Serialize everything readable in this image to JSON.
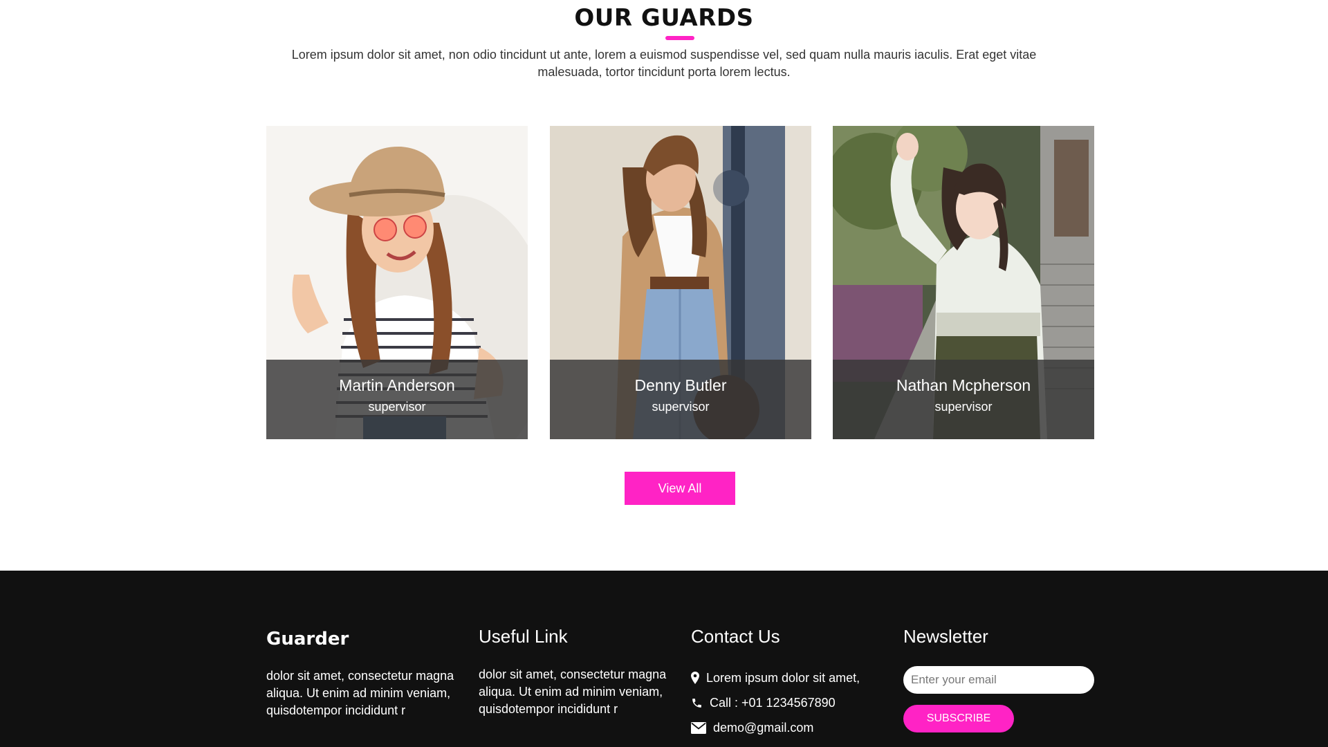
{
  "guards": {
    "title": "OUR GUARDS",
    "intro": "Lorem ipsum dolor sit amet, non odio tincidunt ut ante, lorem a euismod suspendisse vel, sed quam nulla mauris iaculis. Erat eget vitae malesuada, tortor tincidunt porta lorem lectus.",
    "accent_color": "#ff23c5",
    "cards": [
      {
        "name": "Martin Anderson",
        "role": "supervisor",
        "photo": "woman-in-hat-striped-shirt-photo"
      },
      {
        "name": "Denny Butler",
        "role": "supervisor",
        "photo": "woman-in-camel-blazer-photo"
      },
      {
        "name": "Nathan Mcpherson",
        "role": "supervisor",
        "photo": "woman-in-white-blouse-photo"
      }
    ],
    "view_all_label": "View All"
  },
  "footer": {
    "background": "#111111",
    "brand": {
      "name": "Guarder",
      "text": "dolor sit amet, consectetur magna aliqua. Ut enim ad minim veniam, quisdotempor incididunt r"
    },
    "useful_link": {
      "heading": "Useful Link",
      "text": "dolor sit amet, consectetur magna aliqua. Ut enim ad minim veniam, quisdotempor incididunt r"
    },
    "contact": {
      "heading": "Contact Us",
      "items": [
        {
          "icon": "map-pin-icon",
          "text": "Lorem ipsum dolor sit amet,"
        },
        {
          "icon": "phone-icon",
          "text": "Call : +01 1234567890"
        },
        {
          "icon": "envelope-icon",
          "text": "demo@gmail.com"
        }
      ]
    },
    "newsletter": {
      "heading": "Newsletter",
      "email_placeholder": "Enter your email",
      "subscribe_label": "SUBSCRIBE"
    }
  }
}
